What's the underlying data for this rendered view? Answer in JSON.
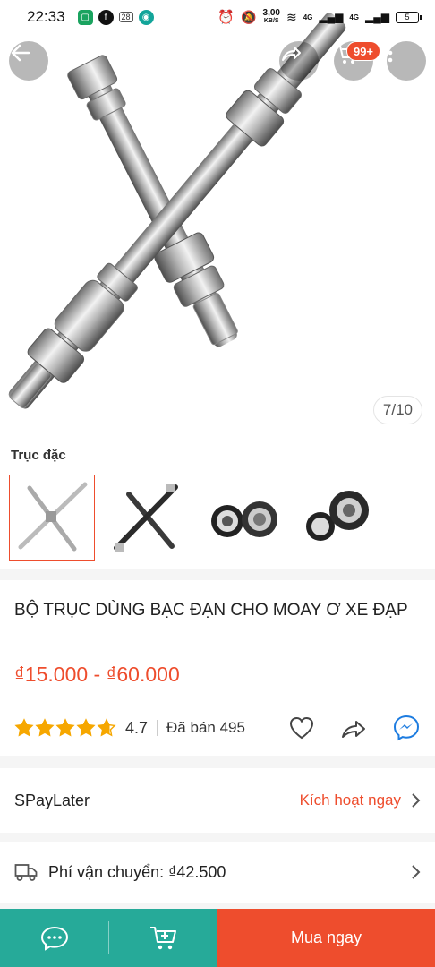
{
  "status_bar": {
    "time": "22:33",
    "net_speed": "3,00",
    "net_unit": "KB/S",
    "battery": "5",
    "calendar_day": "28",
    "signal_1": "4G",
    "signal_2": "4G"
  },
  "hero": {
    "counter": "7/10",
    "cart_badge": "99+"
  },
  "variation": {
    "label": "Trục đặc",
    "thumbnails": [
      "axle-cross-silver",
      "axle-cross-black",
      "bearing-pair",
      "bearing-single"
    ]
  },
  "product": {
    "title": "BỘ TRỤC DÙNG BẠC ĐẠN CHO MOAY Ơ XE ĐẠP",
    "price": "₫15.000 - ₫60.000",
    "rating": "4.7",
    "rating_stars": 4.7,
    "sold": "Đã bán 495"
  },
  "spaylater": {
    "name": "SPayLater",
    "cta": "Kích hoạt ngay"
  },
  "shipping": {
    "text": "Phí vận chuyển: ₫42.500"
  },
  "bottom_bar": {
    "buy_label": "Mua ngay"
  },
  "colors": {
    "brand": "#ee4d2d",
    "chat_bar": "#26aa99",
    "star": "#f6a700"
  }
}
